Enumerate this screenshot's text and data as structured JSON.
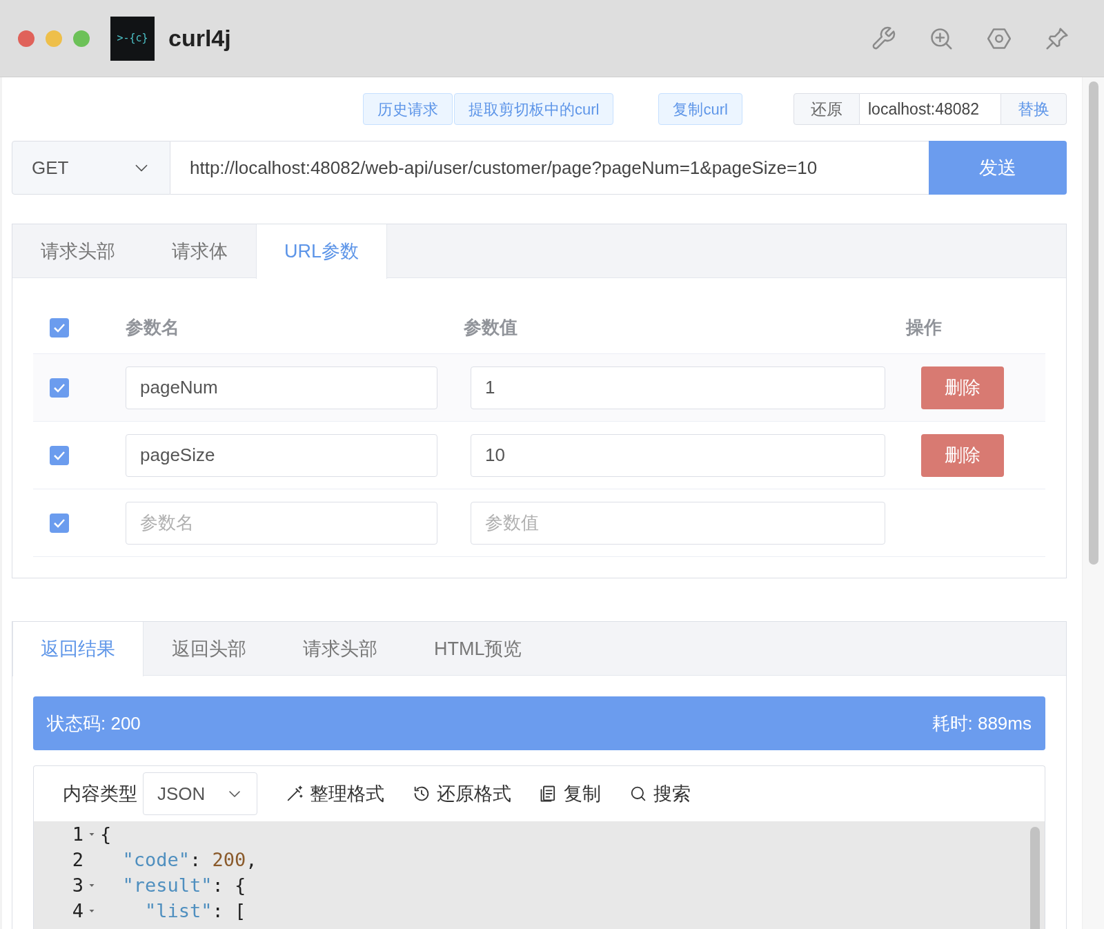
{
  "window": {
    "title": "curl4j",
    "logo_text": ">-{c}"
  },
  "toolbar": {
    "buttons": [
      "历史请求",
      "提取剪切板中的curl",
      "复制curl"
    ],
    "host_group": {
      "restore": "还原",
      "host": "localhost:48082",
      "replace": "替换"
    }
  },
  "request": {
    "method": "GET",
    "url": "http://localhost:48082/web-api/user/customer/page?pageNum=1&pageSize=10",
    "send": "发送"
  },
  "request_tabs": [
    {
      "label": "请求头部",
      "selected": false
    },
    {
      "label": "请求体",
      "selected": false
    },
    {
      "label": "URL参数",
      "selected": true
    }
  ],
  "params": {
    "all_checked": true,
    "columns": [
      "参数名",
      "参数值",
      "操作"
    ],
    "rows": [
      {
        "checked": true,
        "name": "pageNum",
        "value": "1",
        "action": "删除"
      },
      {
        "checked": true,
        "name": "pageSize",
        "value": "10",
        "action": "删除"
      },
      {
        "checked": true,
        "name_placeholder": "参数名",
        "value_placeholder": "参数值"
      }
    ]
  },
  "response_tabs": [
    {
      "label": "返回结果",
      "selected": true
    },
    {
      "label": "返回头部",
      "selected": false
    },
    {
      "label": "请求头部",
      "selected": false
    },
    {
      "label": "HTML预览",
      "selected": false
    }
  ],
  "status": {
    "code": "状态码: 200",
    "time": "耗时: 889ms"
  },
  "editor": {
    "content_type_label": "内容类型",
    "content_type": "JSON",
    "actions": [
      {
        "kind": "format",
        "label": "整理格式"
      },
      {
        "kind": "restore",
        "label": "还原格式"
      },
      {
        "kind": "copy",
        "label": "复制"
      },
      {
        "kind": "search",
        "label": "搜索"
      }
    ],
    "lines": [
      {
        "number": "1",
        "fold": true,
        "parts": [
          {
            "kind": "punct",
            "text": "{"
          }
        ]
      },
      {
        "number": "2",
        "fold": false,
        "parts": [
          {
            "kind": "key",
            "text": "  \"code\""
          },
          {
            "kind": "punct",
            "text": ": "
          },
          {
            "kind": "number",
            "text": "200"
          },
          {
            "kind": "punct",
            "text": ","
          }
        ]
      },
      {
        "number": "3",
        "fold": true,
        "parts": [
          {
            "kind": "key",
            "text": "  \"result\""
          },
          {
            "kind": "punct",
            "text": ": {"
          }
        ]
      },
      {
        "number": "4",
        "fold": true,
        "parts": [
          {
            "kind": "key",
            "text": "    \"list\""
          },
          {
            "kind": "punct",
            "text": ": ["
          }
        ]
      }
    ]
  }
}
